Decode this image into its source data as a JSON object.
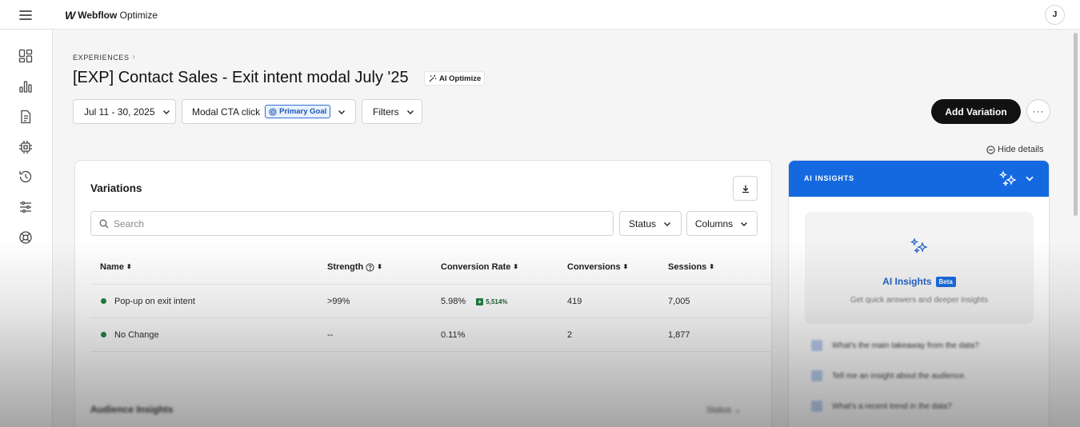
{
  "app": {
    "brand_logo": "W",
    "brand_name": "Webflow",
    "brand_product": "Optimize",
    "avatar_initial": "J"
  },
  "nav": {
    "items": [
      {
        "icon": "dashboard-icon"
      },
      {
        "icon": "bar-chart-icon"
      },
      {
        "icon": "document-icon"
      },
      {
        "icon": "chip-icon"
      },
      {
        "icon": "history-icon"
      },
      {
        "icon": "sliders-icon"
      },
      {
        "icon": "help-circle-icon"
      }
    ]
  },
  "header": {
    "breadcrumb": "EXPERIENCES",
    "title": "[EXP] Contact Sales - Exit intent modal July '25",
    "ai_badge": "AI Optimize"
  },
  "filters": {
    "date_range": "Jul 11 - 30, 2025",
    "goal": "Modal CTA click",
    "goal_badge": "Primary Goal",
    "filters_label": "Filters"
  },
  "actions": {
    "add_variation": "Add Variation",
    "more": "···",
    "hide_details": "Hide details"
  },
  "variations": {
    "title": "Variations",
    "search_placeholder": "Search",
    "status_label": "Status",
    "columns_label": "Columns",
    "headers": [
      "Name",
      "Strength",
      "Conversion Rate",
      "Conversions",
      "Sessions"
    ],
    "rows": [
      {
        "name": "Pop-up on exit intent",
        "strength": ">99%",
        "conversion_rate": "5.98%",
        "lift": "5,514%",
        "conversions": "419",
        "sessions": "7,005"
      },
      {
        "name": "No Change",
        "strength": "--",
        "conversion_rate": "0.11%",
        "lift": "",
        "conversions": "2",
        "sessions": "1,877"
      }
    ]
  },
  "audience": {
    "title": "Audience Insights",
    "status_label": "Status"
  },
  "ai_insights": {
    "header": "AI INSIGHTS",
    "title": "AI Insights",
    "beta": "Beta",
    "subtitle": "Get quick answers and deeper insights",
    "questions": [
      "What's the main takeaway from the data?",
      "Tell me an insight about the audience.",
      "What's a recent trend in the data?"
    ]
  },
  "colors": {
    "accent_blue": "#1569e0",
    "success_green": "#1c7c3a",
    "primary_button": "#111111"
  }
}
